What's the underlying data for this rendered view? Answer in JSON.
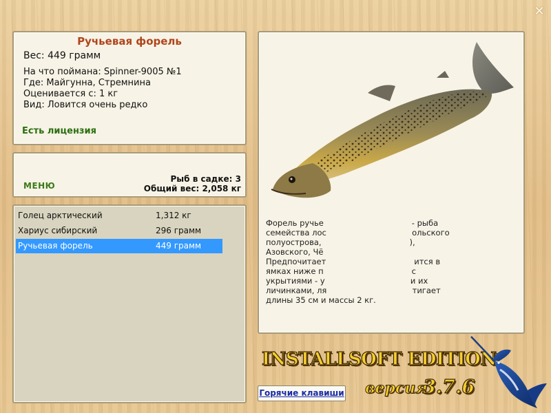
{
  "window": {
    "close_symbol": "✕"
  },
  "catch": {
    "title": "Ручьевая форель",
    "weight_line": "Вес: 449 грамм",
    "details": [
      "На что поймана: Spinner-9005 №1",
      "Где: Майгунна, Стремнина",
      "Оценивается с: 1 кг",
      "Вид: Ловится очень редко"
    ],
    "license": "Есть лицензия"
  },
  "status": {
    "menu_label": "МЕНЮ",
    "fish_count": "Рыб в садке: 3",
    "total_weight": "Общий вес: 2,058 кг"
  },
  "keepnet": {
    "rows": [
      {
        "name": "Голец арктический",
        "weight": "1,312 кг",
        "selected": false
      },
      {
        "name": "Хариус сибирский",
        "weight": "296 грамм",
        "selected": false
      },
      {
        "name": "Ручьевая форель",
        "weight": "449 грамм",
        "selected": true
      }
    ]
  },
  "description": {
    "lines": [
      "Форель ручье                                   - рыба",
      "семейства лос                                  ольского",
      "полуострова,                                   ),",
      "Азовского, Чё",
      "Предпочитает                                   ится в",
      "ямках ниже п                                   с",
      "укрытиями - у                                  и их",
      "личинками, ля                                  тигает",
      "длины 35 см и массы 2 кг."
    ]
  },
  "buttons": {
    "hotkeys": "Горячие клавиши"
  },
  "brand": {
    "title": "INSTALLSOFT EDITION",
    "version_word": "версия",
    "version_number": "3.7.6"
  },
  "icons": {
    "fish_image": "brown-trout-image",
    "logo": "marlin-logo-icon",
    "close": "close-icon"
  },
  "colors": {
    "title": "#b0451c",
    "license": "#2b6f10",
    "menu": "#3b7a18",
    "selection": "#3399ff",
    "link": "#1a2aa8",
    "brand": "#f5ce2e"
  }
}
